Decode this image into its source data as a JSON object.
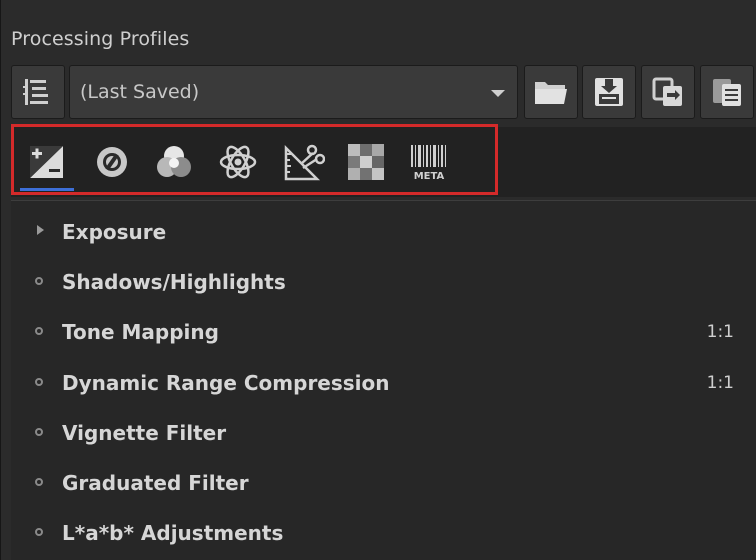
{
  "panel": {
    "title": "Processing Profiles"
  },
  "toolbar": {
    "profile_value": "(Last Saved)",
    "icons": {
      "list": "profile-list-icon",
      "open": "folder-open-icon",
      "save": "save-icon",
      "copy": "copy-icon",
      "paste": "paste-icon"
    }
  },
  "tabs": [
    {
      "name": "exposure-tab",
      "icon": "plus-minus-exposure-icon",
      "active": true
    },
    {
      "name": "detail-tab",
      "icon": "detail-lens-icon"
    },
    {
      "name": "color-tab",
      "icon": "color-circles-icon"
    },
    {
      "name": "advanced-tab",
      "icon": "atom-icon"
    },
    {
      "name": "transform-tab",
      "icon": "ruler-scissors-icon"
    },
    {
      "name": "raw-tab",
      "icon": "checker-icon"
    },
    {
      "name": "metadata-tab",
      "icon": "barcode-icon",
      "label": "META"
    }
  ],
  "accent_color": "#3d6fd8",
  "highlight_color": "#d42a2a",
  "tools": [
    {
      "label": "Exposure",
      "marker": "expander",
      "badge": ""
    },
    {
      "label": "Shadows/Highlights",
      "marker": "circle",
      "badge": ""
    },
    {
      "label": "Tone Mapping",
      "marker": "circle",
      "badge": "1:1"
    },
    {
      "label": "Dynamic Range Compression",
      "marker": "circle",
      "badge": "1:1"
    },
    {
      "label": "Vignette Filter",
      "marker": "circle",
      "badge": ""
    },
    {
      "label": "Graduated Filter",
      "marker": "circle",
      "badge": ""
    },
    {
      "label": "L*a*b* Adjustments",
      "marker": "circle",
      "badge": ""
    }
  ]
}
